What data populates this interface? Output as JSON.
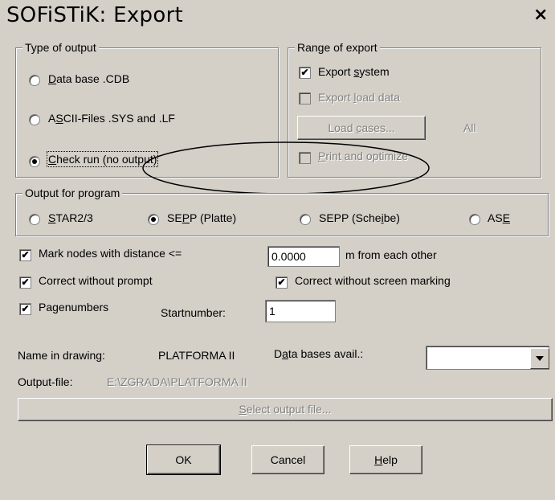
{
  "window": {
    "title": "SOFiSTiK: Export",
    "close_glyph": "×"
  },
  "type_of_output": {
    "legend": "Type of output",
    "options": [
      {
        "pre": "",
        "ul": "D",
        "post": "ata base .CDB",
        "selected": false
      },
      {
        "pre": "A",
        "ul": "S",
        "post": "CII-Files .SYS and .LF",
        "selected": false
      },
      {
        "pre": "",
        "ul": "C",
        "post": "heck run (no output)",
        "selected": true
      }
    ]
  },
  "range_of_export": {
    "legend": "Range of export",
    "export_system": {
      "pre": "Export ",
      "ul": "s",
      "post": "ystem",
      "checked": true
    },
    "export_load_data": {
      "pre": "Export ",
      "ul": "l",
      "post": "oad data",
      "checked": false
    },
    "load_cases_button": {
      "pre": "Load ",
      "ul": "c",
      "post": "ases..."
    },
    "load_cases_value": "All",
    "print_optimize": {
      "pre": "",
      "ul": "P",
      "post": "rint and optimize",
      "checked": false
    }
  },
  "output_for_program": {
    "legend": "Output for program",
    "options": [
      {
        "pre": "",
        "ul": "S",
        "post": "TAR2/3",
        "selected": false
      },
      {
        "pre": "SE",
        "ul": "P",
        "post": "P (Platte)",
        "selected": true
      },
      {
        "pre": "SEPP (Sche",
        "ul": "i",
        "post": "be)",
        "selected": false
      },
      {
        "pre": "AS",
        "ul": "E",
        "post": "",
        "selected": false
      }
    ]
  },
  "mark_nodes": {
    "label": "Mark nodes with distance <=",
    "checked": true,
    "value": "0.0000",
    "suffix": "m from each other"
  },
  "correct_without_prompt": {
    "label": "Correct without prompt",
    "checked": true
  },
  "correct_without_marking": {
    "label": "Correct without screen marking",
    "checked": true
  },
  "pagenumbers": {
    "label": "Pagenumbers",
    "checked": true,
    "start_label": "Startnumber:",
    "start_value": "1"
  },
  "drawing": {
    "name_label": "Name in drawing:",
    "name_value": "PLATFORMA II",
    "db_label_pre": "D",
    "db_label_ul": "a",
    "db_label_post": "ta bases avail.:",
    "db_value": ""
  },
  "output_file": {
    "label": "Output-file:",
    "value": "E:\\ZGRADA\\PLATFORMA II",
    "select_pre": "",
    "select_ul": "S",
    "select_post": "elect output file..."
  },
  "buttons": {
    "ok": "OK",
    "cancel": "Cancel",
    "help_ul": "H",
    "help_post": "elp"
  },
  "check_glyph": "✔"
}
